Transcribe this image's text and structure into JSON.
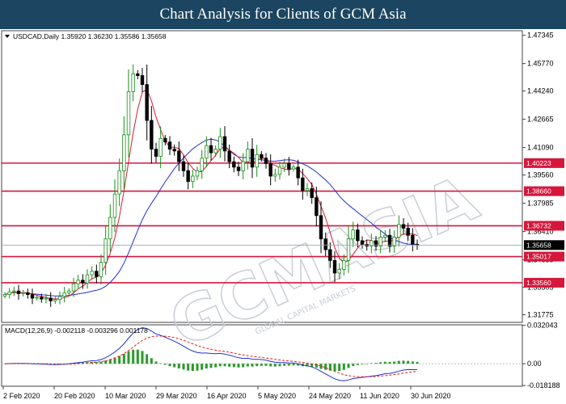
{
  "banner": {
    "title": "Chart Analysis for Clients of GCM Asia"
  },
  "chart_data": [
    {
      "type": "candlestick",
      "symbol_header": "USDCAD,Daily  1.35920 1.36230 1.35586 1.35658",
      "ylim": [
        1.3135,
        1.476
      ],
      "y_ticks": [
        "1.47345",
        "1.45770",
        "1.44240",
        "1.42665",
        "1.41090",
        "1.39560",
        "1.37985",
        "1.36410",
        "1.34835",
        "1.33305",
        "1.31775"
      ],
      "x_ticks": [
        "2 Feb 2020",
        "20 Feb 2020",
        "10 Mar 2020",
        "29 Mar 2020",
        "16 Apr 2020",
        "5 May 2020",
        "24 May 2020",
        "11 Jun 2020",
        "30 Jun 2020"
      ],
      "current_price": "1.35658",
      "levels": [
        {
          "value": 1.40223,
          "label": "1.40223"
        },
        {
          "value": 1.3866,
          "label": "1.38660"
        },
        {
          "value": 1.36732,
          "label": "1.36732"
        },
        {
          "value": 1.35017,
          "label": "1.35017"
        },
        {
          "value": 1.3356,
          "label": "1.33560"
        }
      ],
      "series": [
        {
          "close": [
            1.329,
            1.3305,
            1.331,
            1.3295,
            1.33,
            1.329,
            1.327,
            1.3275,
            1.3265,
            1.327,
            1.3255,
            1.3262,
            1.328,
            1.33,
            1.331,
            1.335,
            1.337,
            1.3355,
            1.34,
            1.342,
            1.339,
            1.347,
            1.36,
            1.372,
            1.385,
            1.398,
            1.418,
            1.442,
            1.452,
            1.451,
            1.446,
            1.426,
            1.41,
            1.406,
            1.416,
            1.414,
            1.41,
            1.409,
            1.403,
            1.398,
            1.392,
            1.395,
            1.398,
            1.405,
            1.412,
            1.408,
            1.41,
            1.417,
            1.409,
            1.403,
            1.4,
            1.398,
            1.403,
            1.41,
            1.4,
            1.407,
            1.405,
            1.402,
            1.395,
            1.396,
            1.4,
            1.402,
            1.399,
            1.4,
            1.394,
            1.387,
            1.388,
            1.383,
            1.373,
            1.36,
            1.354,
            1.348,
            1.341,
            1.343,
            1.348,
            1.36,
            1.365,
            1.359,
            1.357,
            1.356,
            1.359,
            1.356,
            1.361,
            1.362,
            1.356,
            1.361,
            1.368,
            1.366,
            1.362,
            1.357,
            1.3566
          ]
        },
        {
          "name": "",
          "values": []
        }
      ]
    },
    {
      "type": "macd",
      "header": "MACD(12,26,9) -0.002118 -0.003296 0.001178",
      "ylim": [
        -0.0188,
        0.0325
      ],
      "y_ticks": [
        "0.032043",
        "0.00",
        "-0.018188"
      ]
    }
  ],
  "colors": {
    "bull": "#1a8f1a",
    "bear": "#000000",
    "ma_fast": "#d81a32",
    "ma_slow": "#2430d8",
    "level_line": "#d6173c",
    "macd_hist": "#2a9a2a",
    "macd_signal": "#e02020",
    "macd_line": "#2030d0"
  },
  "watermark": {
    "text": "GCMASIA",
    "sub": "GLOBAL CAPITAL MARKETS"
  }
}
